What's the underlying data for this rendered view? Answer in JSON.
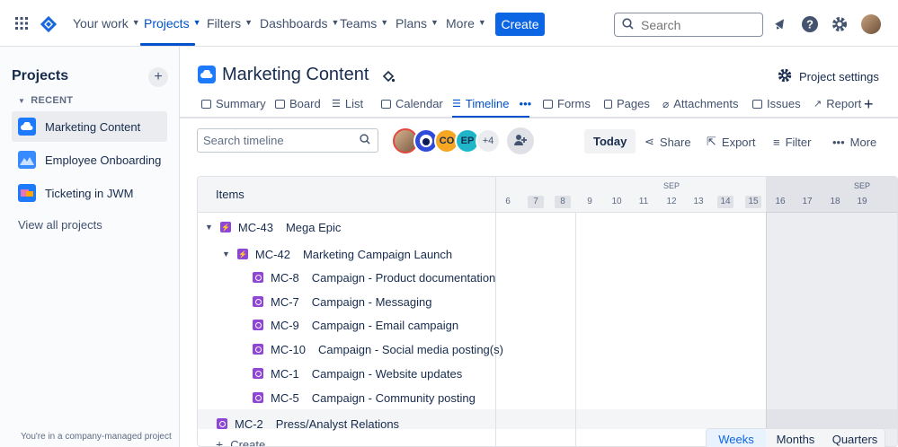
{
  "topnav": {
    "items": [
      "Your work",
      "Projects",
      "Filters",
      "Dashboards",
      "Teams",
      "Plans",
      "More"
    ],
    "create_label": "Create",
    "search_placeholder": "Search"
  },
  "sidebar": {
    "title": "Projects",
    "recent_label": "RECENT",
    "projects": [
      {
        "name": "Marketing Content",
        "color": "#1d7afc"
      },
      {
        "name": "Employee Onboarding",
        "color": "#1d7afc"
      },
      {
        "name": "Ticketing in JWM",
        "color": "#1d7afc"
      }
    ],
    "view_all": "View all projects",
    "footer": "You're in a company-managed project"
  },
  "project": {
    "title": "Marketing Content",
    "settings_label": "Project settings"
  },
  "tabs": [
    "Summary",
    "Board",
    "List",
    "Calendar",
    "Timeline",
    "Forms",
    "Pages",
    "Attachments",
    "Issues",
    "Reports"
  ],
  "toolbar": {
    "search_placeholder": "Search timeline",
    "avatars": [
      {
        "initials": "",
        "color": "#b0805a"
      },
      {
        "initials": "",
        "color": "#2f4bd8"
      },
      {
        "initials": "CO",
        "color": "#f5a623"
      },
      {
        "initials": "EP",
        "color": "#1fb6c9"
      }
    ],
    "more_avatars": "+4",
    "today": "Today",
    "share": "Share",
    "export": "Export",
    "filter": "Filter",
    "more": "More"
  },
  "timeline": {
    "items_header": "Items",
    "month": "SEP",
    "days": [
      "6",
      "7",
      "8",
      "9",
      "10",
      "11",
      "12",
      "13",
      "14",
      "15",
      "16",
      "17",
      "18",
      "19"
    ],
    "rows": [
      {
        "key": "MC-43",
        "title": "Mega Epic",
        "type": "epic",
        "level": 0
      },
      {
        "key": "MC-42",
        "title": "Marketing Campaign Launch",
        "type": "epic",
        "level": 1
      },
      {
        "key": "MC-8",
        "title": "Campaign - Product documentation",
        "type": "task",
        "level": 2
      },
      {
        "key": "MC-7",
        "title": "Campaign - Messaging",
        "type": "task",
        "level": 2
      },
      {
        "key": "MC-9",
        "title": "Campaign - Email campaign",
        "type": "task",
        "level": 2
      },
      {
        "key": "MC-10",
        "title": "Campaign - Social media posting(s)",
        "type": "task",
        "level": 2
      },
      {
        "key": "MC-1",
        "title": "Campaign - Website updates",
        "type": "task",
        "level": 2
      },
      {
        "key": "MC-5",
        "title": "Campaign - Community posting",
        "type": "task",
        "level": 2
      },
      {
        "key": "MC-2",
        "title": "Press/Analyst Relations",
        "type": "task",
        "level": 0
      }
    ],
    "create_label": "Create",
    "zoom": [
      "Weeks",
      "Months",
      "Quarters"
    ]
  }
}
